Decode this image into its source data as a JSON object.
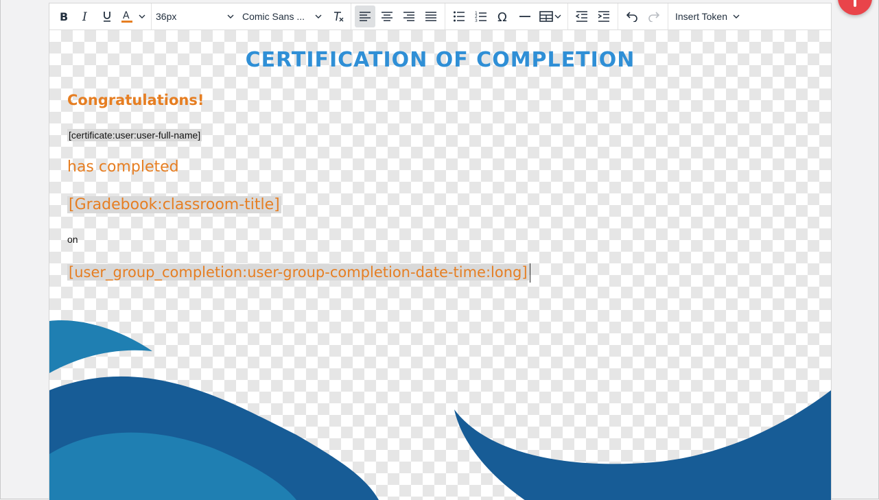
{
  "toolbar": {
    "font_size": "36px",
    "font_family": "Comic Sans ...",
    "insert_token_label": "Insert Token",
    "text_color": "#e67e22"
  },
  "icons": [
    "bold-icon",
    "italic-icon",
    "underline-icon",
    "text-color-icon",
    "chevron-down-icon",
    "clear-formatting-icon",
    "align-left-icon",
    "align-center-icon",
    "align-right-icon",
    "justify-icon",
    "bullet-list-icon",
    "numbered-list-icon",
    "special-character-icon",
    "horizontal-line-icon",
    "table-icon",
    "outdent-icon",
    "indent-icon",
    "undo-icon",
    "redo-icon"
  ],
  "document": {
    "title": "CERTIFICATION OF COMPLETION",
    "congrats": "Congratulations!",
    "user_token": "[certificate:user:user-full-name]",
    "has_completed": "has completed",
    "classroom_token": "[Gradebook:classroom-title]",
    "on": "on",
    "date_token": "[user_group_completion:user-group-completion-date-time:long]"
  },
  "colors": {
    "title": "#2f8fd6",
    "accent_text": "#e67e22",
    "wave_dark": "#175c96",
    "wave_light": "#1f7fb2",
    "fab": "#e9444a"
  }
}
